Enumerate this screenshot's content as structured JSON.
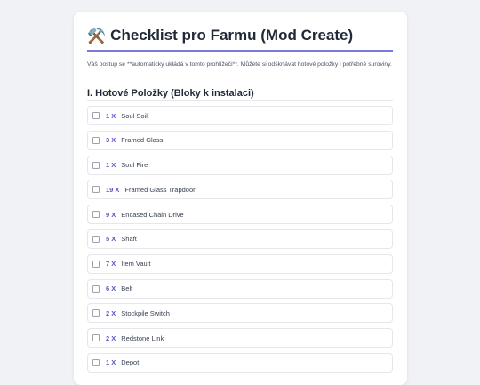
{
  "header": {
    "icon": "⚒️",
    "title": "Checklist pro Farmu (Mod Create)",
    "description": "Váš postup se **automaticky ukládá v tomto prohlížeči**. Můžete si odškrtávat hotové položky i potřebné suroviny."
  },
  "section": {
    "title": "I. Hotové Položky (Bloky k instalaci)"
  },
  "items": [
    {
      "qty": "1 X",
      "name": "Soul Soil",
      "checked": false
    },
    {
      "qty": "3 X",
      "name": "Framed Glass",
      "checked": false
    },
    {
      "qty": "1 X",
      "name": "Soul Fire",
      "checked": false
    },
    {
      "qty": "19 X",
      "name": "Framed Glass Trapdoor",
      "checked": false
    },
    {
      "qty": "9 X",
      "name": "Encased Chain Drive",
      "checked": false
    },
    {
      "qty": "5 X",
      "name": "Shaft",
      "checked": false
    },
    {
      "qty": "7 X",
      "name": "Item Vault",
      "checked": false
    },
    {
      "qty": "6 X",
      "name": "Belt",
      "checked": false
    },
    {
      "qty": "2 X",
      "name": "Stockpile Switch",
      "checked": false
    },
    {
      "qty": "2 X",
      "name": "Redstone Link",
      "checked": false
    },
    {
      "qty": "1 X",
      "name": "Depot",
      "checked": false
    }
  ],
  "colors": {
    "accent": "#7b79e0",
    "quantity": "#5b55c9",
    "background": "#f1f2f5"
  }
}
